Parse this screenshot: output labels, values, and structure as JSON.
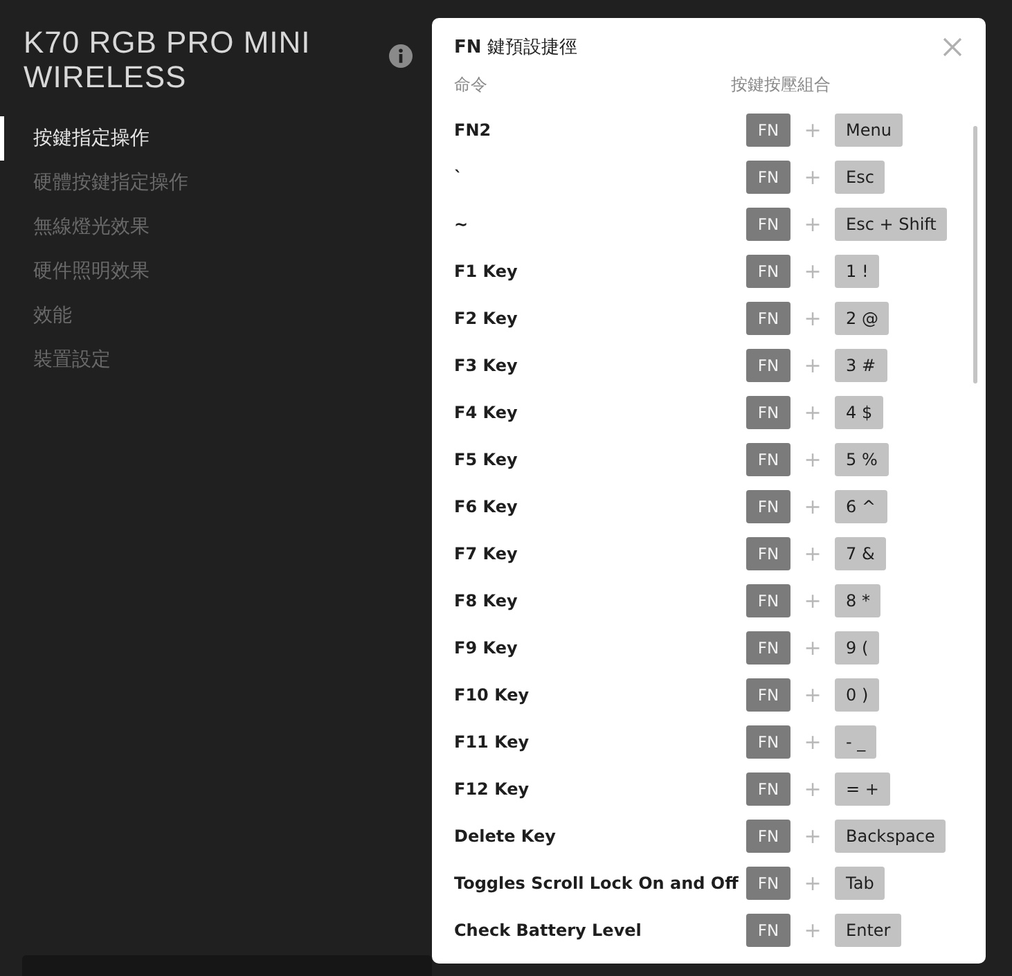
{
  "device": {
    "title": "K70 RGB PRO MINI WIRELESS"
  },
  "sidebar": {
    "items": [
      {
        "label": "按鍵指定操作",
        "selected": true
      },
      {
        "label": "硬體按鍵指定操作",
        "selected": false
      },
      {
        "label": "無線燈光效果",
        "selected": false
      },
      {
        "label": "硬件照明效果",
        "selected": false
      },
      {
        "label": "效能",
        "selected": false
      },
      {
        "label": "裝置設定",
        "selected": false
      }
    ]
  },
  "dialog": {
    "title": "**FN** 鍵預設捷徑",
    "columns": [
      "命令",
      "按鍵按壓組合"
    ],
    "rows": [
      {
        "command": "FN2",
        "modifier": "FN",
        "plus": "+",
        "key": "Menu"
      },
      {
        "command": "`",
        "modifier": "FN",
        "plus": "+",
        "key": "Esc"
      },
      {
        "command": "~",
        "modifier": "FN",
        "plus": "+",
        "key": "Esc + Shift"
      },
      {
        "command": "F1 Key",
        "modifier": "FN",
        "plus": "+",
        "key": "1 !"
      },
      {
        "command": "F2 Key",
        "modifier": "FN",
        "plus": "+",
        "key": "2 @"
      },
      {
        "command": "F3 Key",
        "modifier": "FN",
        "plus": "+",
        "key": "3 #"
      },
      {
        "command": "F4 Key",
        "modifier": "FN",
        "plus": "+",
        "key": "4 $"
      },
      {
        "command": "F5 Key",
        "modifier": "FN",
        "plus": "+",
        "key": "5 %"
      },
      {
        "command": "F6 Key",
        "modifier": "FN",
        "plus": "+",
        "key": "6 ^"
      },
      {
        "command": "F7 Key",
        "modifier": "FN",
        "plus": "+",
        "key": "7 &"
      },
      {
        "command": "F8 Key",
        "modifier": "FN",
        "plus": "+",
        "key": "8 *"
      },
      {
        "command": "F9 Key",
        "modifier": "FN",
        "plus": "+",
        "key": "9 ("
      },
      {
        "command": "F10 Key",
        "modifier": "FN",
        "plus": "+",
        "key": "0 )"
      },
      {
        "command": "F11 Key",
        "modifier": "FN",
        "plus": "+",
        "key": "- _"
      },
      {
        "command": "F12 Key",
        "modifier": "FN",
        "plus": "+",
        "key": "= +"
      },
      {
        "command": "Delete Key",
        "modifier": "FN",
        "plus": "+",
        "key": "Backspace"
      },
      {
        "command": "Toggles Scroll Lock On and Off",
        "modifier": "FN",
        "plus": "+",
        "key": "Tab"
      },
      {
        "command": "Check Battery Level",
        "modifier": "FN",
        "plus": "+",
        "key": "Enter"
      }
    ]
  }
}
